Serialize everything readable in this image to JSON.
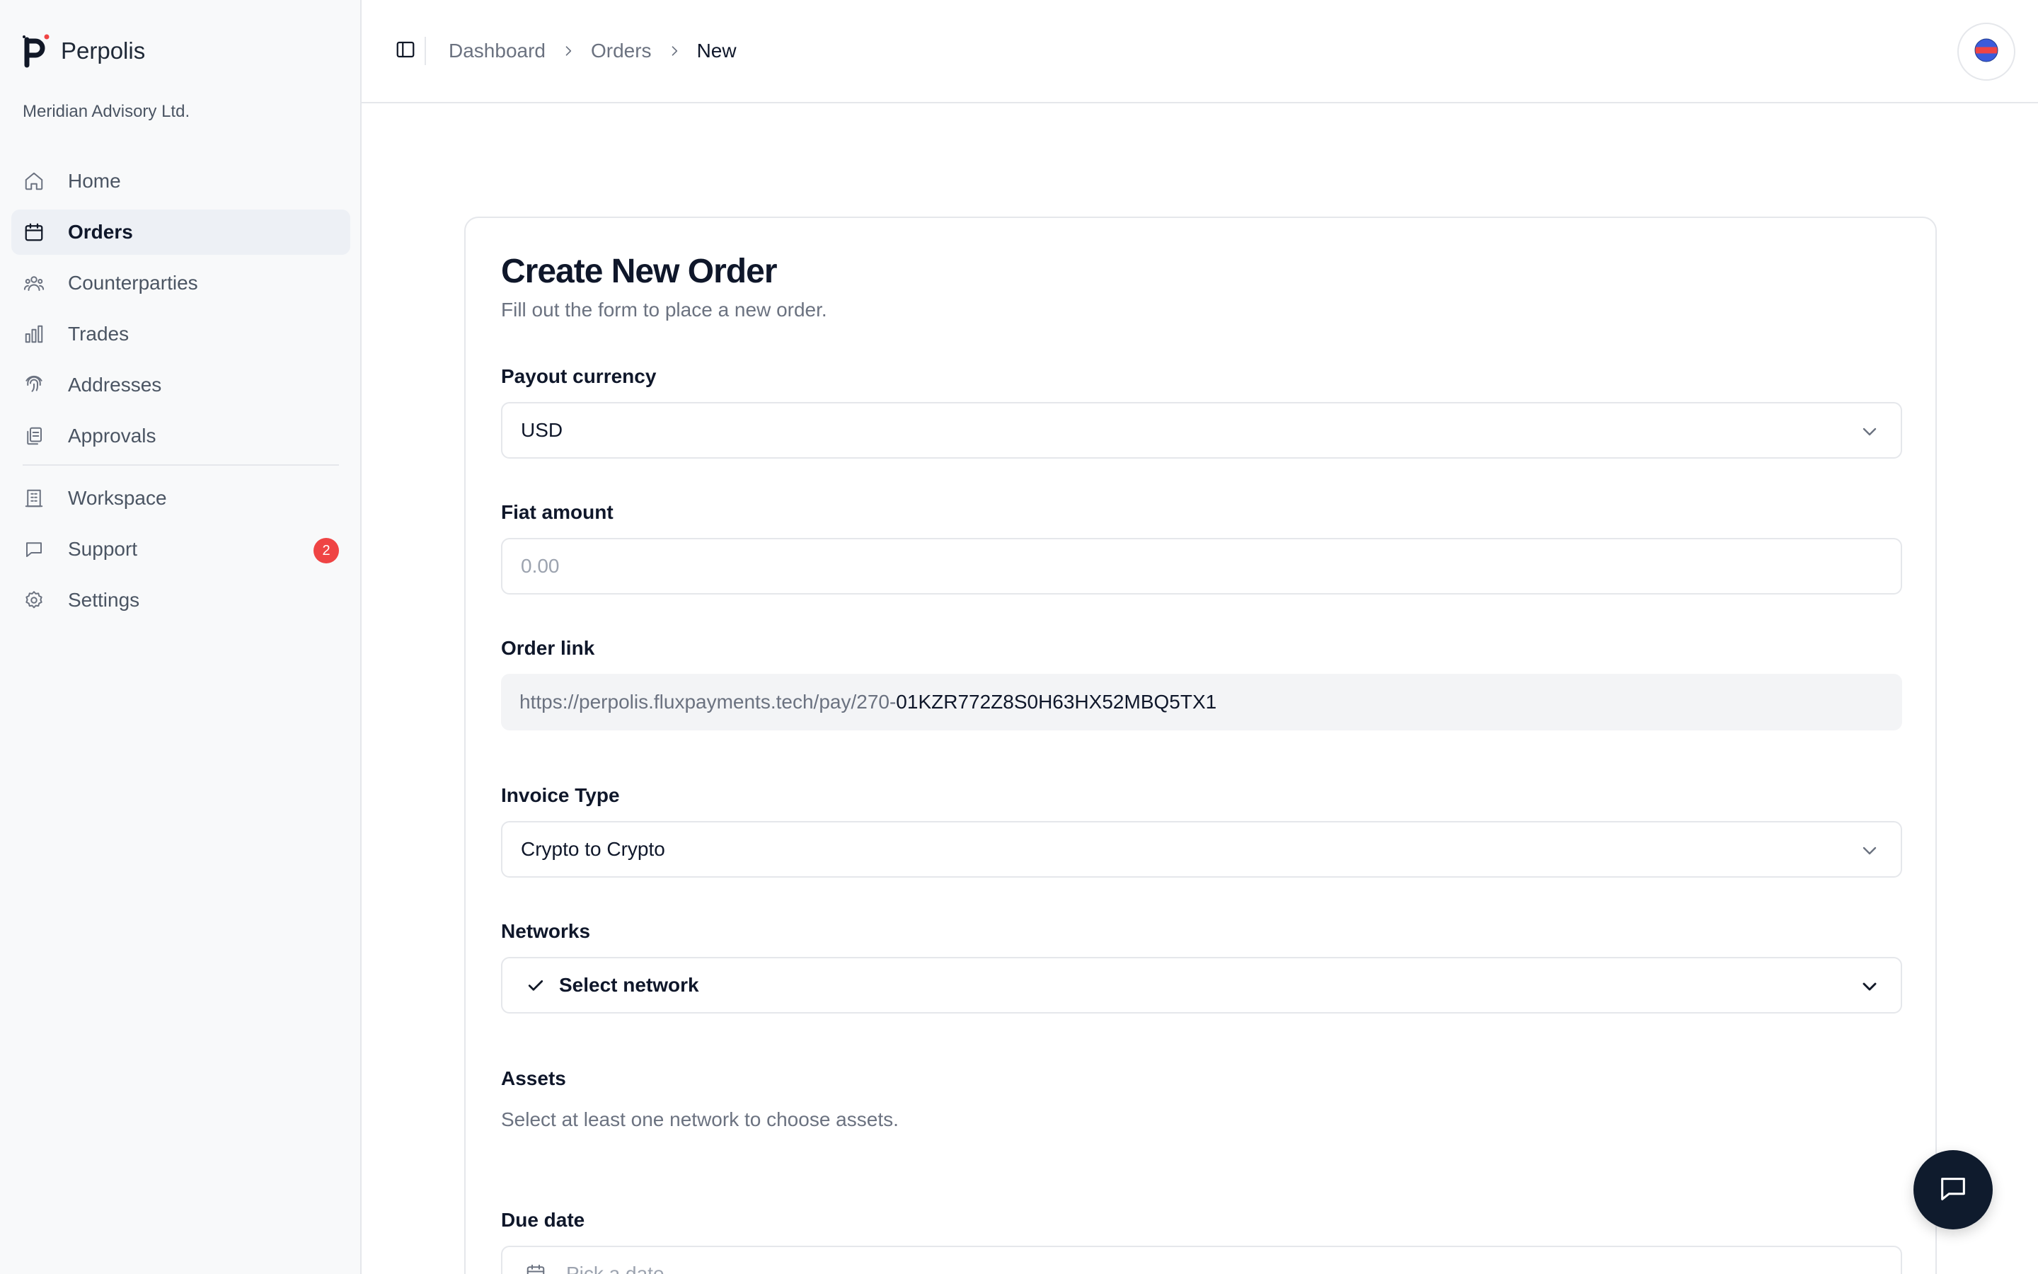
{
  "brand": {
    "name": "Perpolis",
    "org": "Meridian Advisory Ltd."
  },
  "sidebar": {
    "items": [
      {
        "label": "Home",
        "icon": "home-icon"
      },
      {
        "label": "Orders",
        "icon": "calendar-icon",
        "active": true
      },
      {
        "label": "Counterparties",
        "icon": "users-icon"
      },
      {
        "label": "Trades",
        "icon": "bar-chart-icon"
      },
      {
        "label": "Addresses",
        "icon": "fingerprint-icon"
      },
      {
        "label": "Approvals",
        "icon": "clipboard-copy-icon"
      },
      {
        "label": "Workspace",
        "icon": "building-icon"
      },
      {
        "label": "Support",
        "icon": "message-icon",
        "badge": "2"
      },
      {
        "label": "Settings",
        "icon": "gear-icon"
      }
    ]
  },
  "breadcrumb": [
    "Dashboard",
    "Orders",
    "New"
  ],
  "form": {
    "title": "Create New Order",
    "subtitle": "Fill out the form to place a new order.",
    "payout_currency": {
      "label": "Payout currency",
      "value": "USD"
    },
    "fiat_amount": {
      "label": "Fiat amount",
      "placeholder": "0.00"
    },
    "order_link": {
      "label": "Order link",
      "prefix": "https://perpolis.fluxpayments.tech/pay/270-",
      "suffix": "01KZR772Z8S0H63HX52MBQ5TX1"
    },
    "invoice_type": {
      "label": "Invoice Type",
      "value": "Crypto to Crypto"
    },
    "networks": {
      "label": "Networks",
      "value": "Select network"
    },
    "assets": {
      "label": "Assets",
      "helper": "Select at least one network to choose assets."
    },
    "due_date": {
      "label": "Due date",
      "placeholder": "Pick a date"
    }
  },
  "colors": {
    "badge": "#ef4444",
    "chat_button": "#0f1b2d",
    "active_nav": "#edf0f5"
  }
}
